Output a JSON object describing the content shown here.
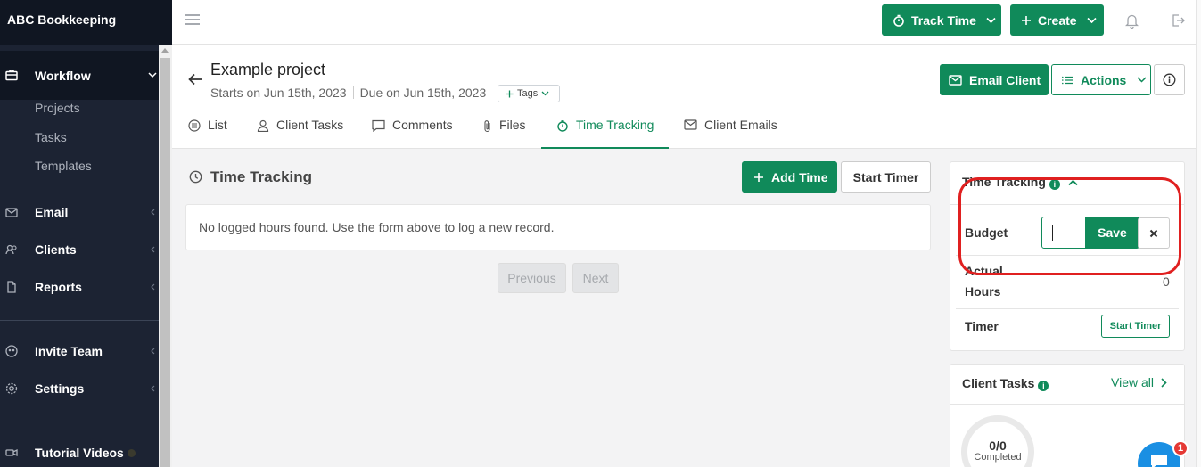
{
  "app": {
    "brand": "ABC Bookkeeping"
  },
  "sidebar": {
    "workflow": "Workflow",
    "workflow_sub": [
      "Projects",
      "Tasks",
      "Templates"
    ],
    "email": "Email",
    "clients": "Clients",
    "reports": "Reports",
    "invite_team": "Invite Team",
    "settings": "Settings",
    "tutorial_videos": "Tutorial Videos"
  },
  "topbar": {
    "track_time": "Track Time",
    "create": "Create"
  },
  "project": {
    "title": "Example project",
    "starts": "Starts on Jun 15th, 2023",
    "due": "Due on Jun 15th, 2023",
    "tags": "Tags",
    "email_client": "Email Client",
    "actions": "Actions"
  },
  "tabs": [
    "List",
    "Client Tasks",
    "Comments",
    "Files",
    "Time Tracking",
    "Client Emails"
  ],
  "main": {
    "section_title": "Time Tracking",
    "add_time": "Add Time",
    "start_timer": "Start Timer",
    "empty_message": "No logged hours found. Use the form above to log a new record.",
    "previous": "Previous",
    "next": "Next"
  },
  "time_panel": {
    "title": "Time Tracking",
    "budget_label": "Budget",
    "budget_value": "",
    "save": "Save",
    "actual_label": "Actual",
    "hours_label": "Hours",
    "actual_value": "0",
    "timer_label": "Timer",
    "start_timer": "Start Timer"
  },
  "client_tasks_panel": {
    "title": "Client Tasks",
    "view_all": "View all",
    "progress": "0/0",
    "progress_label": "Completed"
  },
  "chat": {
    "badge": "1"
  },
  "colors": {
    "accent": "#108a5a",
    "sidebar": "#1c2333",
    "annotation": "#e02020"
  }
}
